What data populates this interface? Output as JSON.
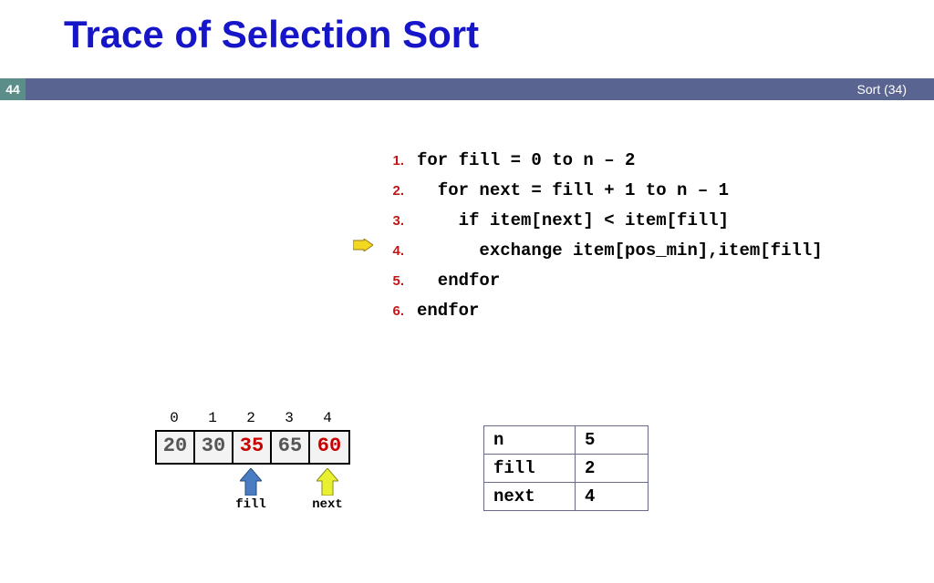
{
  "title": "Trace of Selection Sort",
  "page_number": "44",
  "bar_right": "Sort (34)",
  "code": {
    "lines": [
      {
        "n": "1.",
        "text": "for fill = 0 to n – 2"
      },
      {
        "n": "2.",
        "text": "  for next = fill + 1 to n – 1"
      },
      {
        "n": "3.",
        "text": "    if item[next] < item[fill]"
      },
      {
        "n": "4.",
        "text": "      exchange item[pos_min],item[fill]"
      },
      {
        "n": "5.",
        "text": "  endfor"
      },
      {
        "n": "6.",
        "text": "endfor"
      }
    ],
    "marker_at_line_index": 3
  },
  "array": {
    "indices": [
      "0",
      "1",
      "2",
      "3",
      "4"
    ],
    "cells": [
      {
        "value": "20",
        "highlight": false
      },
      {
        "value": "30",
        "highlight": false
      },
      {
        "value": "35",
        "highlight": true
      },
      {
        "value": "65",
        "highlight": false
      },
      {
        "value": "60",
        "highlight": true
      }
    ],
    "pointers": {
      "fill": {
        "index": 2,
        "label": "fill",
        "color": "#4a7cc4"
      },
      "next": {
        "index": 4,
        "label": "next",
        "color": "#e8f030"
      }
    }
  },
  "vars": [
    {
      "name": "n",
      "value": "5"
    },
    {
      "name": "fill",
      "value": "2"
    },
    {
      "name": "next",
      "value": "4"
    }
  ]
}
